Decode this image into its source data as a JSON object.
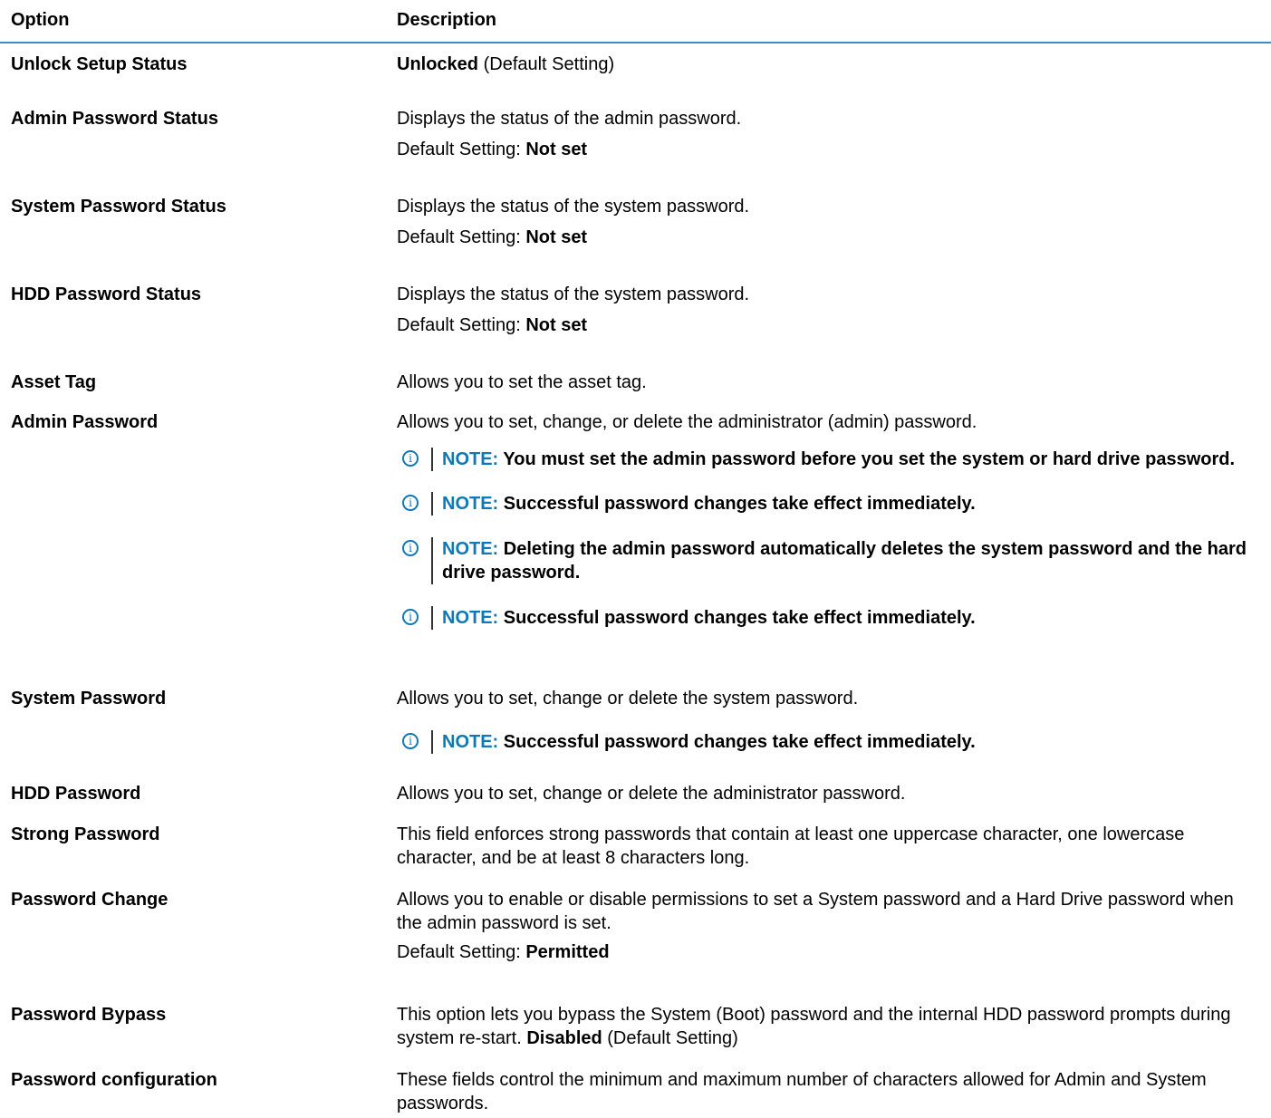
{
  "header": {
    "option": "Option",
    "description": "Description"
  },
  "rows": [
    {
      "option": "Unlock Setup Status",
      "value_bold": "Unlocked",
      "value_rest": " (Default Setting)"
    },
    {
      "option": "Admin Password Status",
      "desc": "Displays the status of the admin password.",
      "default_label": "Default Setting: ",
      "default_value": "Not set"
    },
    {
      "option": "System Password Status",
      "desc": "Displays the status of the system password.",
      "default_label": "Default Setting: ",
      "default_value": "Not set"
    },
    {
      "option": "HDD Password Status",
      "desc": "Displays the status of the system password.",
      "default_label": "Default Setting: ",
      "default_value": "Not set"
    },
    {
      "option": "Asset Tag",
      "desc": "Allows you to set the asset tag."
    },
    {
      "option": "Admin Password",
      "desc": "Allows you to set, change, or delete the administrator (admin) password.",
      "notes": [
        "You must set the admin password before you set the system or hard drive password.",
        "Successful password changes take effect immediately.",
        "Deleting the admin password automatically deletes the system password and the hard drive password.",
        "Successful password changes take effect immediately."
      ]
    },
    {
      "option": "System Password",
      "desc": "Allows you to set, change or delete the system password.",
      "notes": [
        "Successful password changes take effect immediately."
      ]
    },
    {
      "option": "HDD Password",
      "desc": "Allows you to set, change or delete the administrator password."
    },
    {
      "option": "Strong Password",
      "desc": "This field enforces strong passwords that contain at least one uppercase character, one lowercase character, and be at least 8 characters long."
    },
    {
      "option": "Password Change",
      "desc": "Allows you to enable or disable permissions to set a System password and a Hard Drive password when the admin password is set.",
      "default_label": "Default Setting: ",
      "default_value": "Permitted"
    },
    {
      "option": "Password Bypass",
      "desc": "This option lets you bypass the System (Boot) password and the internal HDD password prompts during system re-start. ",
      "value_bold": "Disabled",
      "value_rest": " (Default Setting)"
    },
    {
      "option": "Password configuration",
      "desc": "These fields control the minimum and maximum number of characters allowed for Admin and System passwords."
    }
  ],
  "note_label": "NOTE:",
  "note_icon": "info-circle-icon",
  "accent_color": "#0e79b5"
}
